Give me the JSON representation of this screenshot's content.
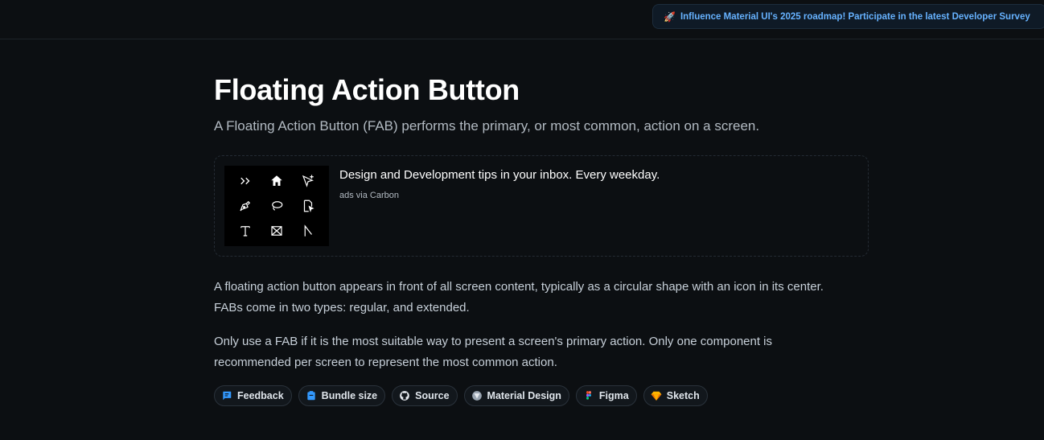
{
  "banner": {
    "text": "Influence Material UI's 2025 roadmap! Participate in the latest Developer Survey",
    "accent": "#66b2ff"
  },
  "page": {
    "title": "Floating Action Button",
    "subtitle": "A Floating Action Button (FAB) performs the primary, or most common, action on a screen."
  },
  "ad": {
    "text": "Design and Development tips in your inbox. Every weekday.",
    "via": "ads via Carbon",
    "icons": [
      "chevrons-icon",
      "home-icon",
      "cursor-plus-icon",
      "pen-tool-icon",
      "lasso-icon",
      "file-cursor-icon",
      "text-icon",
      "frame-icon",
      "slice-icon"
    ]
  },
  "body": {
    "p1": "A floating action button appears in front of all screen content, typically as a circular shape with an icon in its center. FABs come in two types: regular, and extended.",
    "p2": "Only use a FAB if it is the most suitable way to present a screen's primary action. Only one component is recommended per screen to represent the most common action."
  },
  "chips": [
    {
      "label": "Feedback",
      "icon": "feedback-icon"
    },
    {
      "label": "Bundle size",
      "icon": "bundle-icon"
    },
    {
      "label": "Source",
      "icon": "github-icon"
    },
    {
      "label": "Material Design",
      "icon": "material-design-icon"
    },
    {
      "label": "Figma",
      "icon": "figma-icon"
    },
    {
      "label": "Sketch",
      "icon": "sketch-icon"
    }
  ]
}
